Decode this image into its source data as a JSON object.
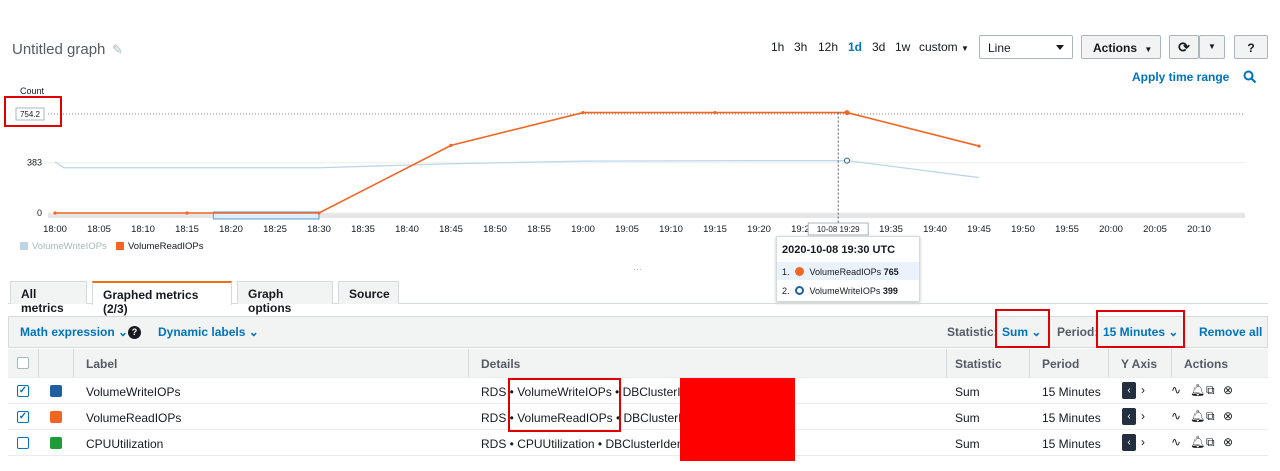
{
  "graph": {
    "title": "Untitled graph",
    "time_ranges": [
      "1h",
      "3h",
      "12h",
      "1d",
      "3d",
      "1w",
      "custom"
    ],
    "active_range": "1d",
    "chart_type": "Line",
    "actions_label": "Actions",
    "apply_time_range": "Apply time range"
  },
  "chart_data": {
    "type": "line",
    "ylabel": "Count",
    "ylim": [
      0,
      800
    ],
    "yticks": [
      0,
      383
    ],
    "threshold_label": "754.2",
    "x": [
      "18:00",
      "18:05",
      "18:10",
      "18:15",
      "18:20",
      "18:25",
      "18:30",
      "18:35",
      "18:40",
      "18:45",
      "18:50",
      "18:55",
      "19:00",
      "19:05",
      "19:10",
      "19:15",
      "19:20",
      "19:25",
      "19:30",
      "19:35",
      "19:40",
      "19:45",
      "19:50",
      "19:55",
      "20:00",
      "20:05",
      "20:10"
    ],
    "series": [
      {
        "name": "VolumeWriteIOPs",
        "color": "#bcd6e8",
        "points": [
          [
            "18:00",
            390
          ],
          [
            "18:01",
            345
          ],
          [
            "18:15",
            345
          ],
          [
            "18:30",
            345
          ],
          [
            "18:45",
            375
          ],
          [
            "19:00",
            395
          ],
          [
            "19:15",
            398
          ],
          [
            "19:30",
            399
          ],
          [
            "19:45",
            270
          ]
        ]
      },
      {
        "name": "VolumeReadIOPs",
        "color": "#f26522",
        "points": [
          [
            "18:00",
            0
          ],
          [
            "18:15",
            0
          ],
          [
            "18:30",
            0
          ],
          [
            "18:45",
            515
          ],
          [
            "19:00",
            765
          ],
          [
            "19:15",
            765
          ],
          [
            "19:30",
            765
          ],
          [
            "19:45",
            510
          ]
        ]
      }
    ],
    "hover_x_label": "10-08 19:29",
    "tooltip": {
      "title": "2020-10-08 19:30 UTC",
      "rows": [
        {
          "index": "1.",
          "name": "VolumeReadIOPs",
          "value": "765"
        },
        {
          "index": "2.",
          "name": "VolumeWriteIOPs",
          "value": "399"
        }
      ]
    }
  },
  "tabs": [
    "All metrics",
    "Graphed metrics (2/3)",
    "Graph options",
    "Source"
  ],
  "selected_tab": "Graphed metrics (2/3)",
  "toolbar": {
    "math_expression": "Math expression",
    "dynamic_labels": "Dynamic labels",
    "statistic_label": "Statistic:",
    "statistic_value": "Sum",
    "period_label": "Period:",
    "period_value": "15 Minutes",
    "remove_all": "Remove all"
  },
  "table": {
    "headers": [
      "Label",
      "Details",
      "Statistic",
      "Period",
      "Y Axis",
      "Actions"
    ],
    "rows": [
      {
        "checked": true,
        "color": "#1f5fa0",
        "label": "VolumeWriteIOPs",
        "ns": "RDS",
        "metric": "VolumeWriteIOPs",
        "dim": "DBClusterIde",
        "statistic": "Sum",
        "period": "15 Minutes"
      },
      {
        "checked": true,
        "color": "#f26522",
        "label": "VolumeReadIOPs",
        "ns": "RDS",
        "metric": "VolumeReadIOPs",
        "dim": "DBClusterIde",
        "statistic": "Sum",
        "period": "15 Minutes"
      },
      {
        "checked": false,
        "color": "#1d9b38",
        "label": "CPUUtilization",
        "ns": "RDS",
        "metric": "CPUUtilization",
        "dim": "DBClusterIdenti",
        "statistic": "Sum",
        "period": "15 Minutes"
      }
    ]
  }
}
